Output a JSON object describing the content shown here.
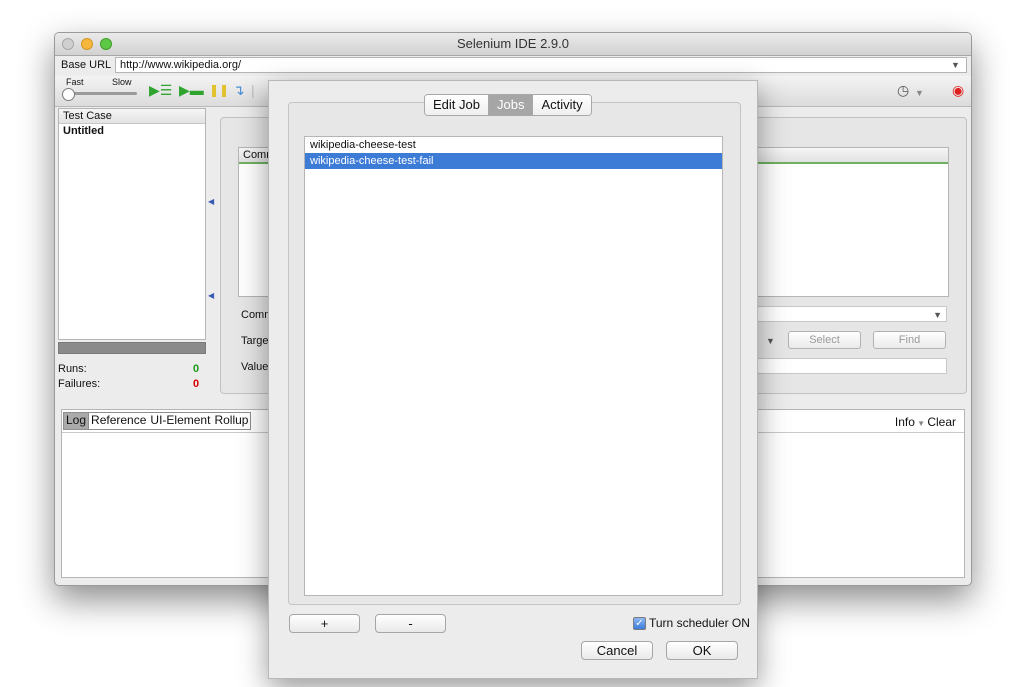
{
  "window": {
    "title": "Selenium IDE 2.9.0"
  },
  "base_url": {
    "label": "Base URL",
    "value": "http://www.wikipedia.org/"
  },
  "toolbar": {
    "speed_fast": "Fast",
    "speed_slow": "Slow",
    "icons": [
      "play-all-icon",
      "play-current-icon",
      "pause-icon",
      "step-icon",
      "record-icon",
      "scheduler-icon"
    ]
  },
  "test_case_pane": {
    "header": "Test Case",
    "items": [
      "Untitled"
    ]
  },
  "stats": {
    "runs_label": "Runs:",
    "runs_value": "0",
    "failures_label": "Failures:",
    "failures_value": "0"
  },
  "editor": {
    "command_header": "Comm",
    "command_label": "Comm",
    "target_label": "Targe",
    "value_label": "Value",
    "select_button": "Select",
    "find_button": "Find"
  },
  "log": {
    "tabs": [
      "Log",
      "Reference",
      "UI-Element",
      "Rollup"
    ],
    "info": "Info",
    "clear": "Clear"
  },
  "dialog": {
    "tabs": [
      "Edit Job",
      "Jobs",
      "Activity"
    ],
    "active_tab": "Jobs",
    "jobs": [
      "wikipedia-cheese-test",
      "wikipedia-cheese-test-fail"
    ],
    "selected_job": "wikipedia-cheese-test-fail",
    "add_button": "+",
    "remove_button": "-",
    "scheduler_label": "Turn scheduler ON",
    "scheduler_checked": true,
    "cancel_button": "Cancel",
    "ok_button": "OK"
  },
  "colors": {
    "selection": "#3c7bd6",
    "failures": "#d40000",
    "runs": "#1a9a1a"
  }
}
